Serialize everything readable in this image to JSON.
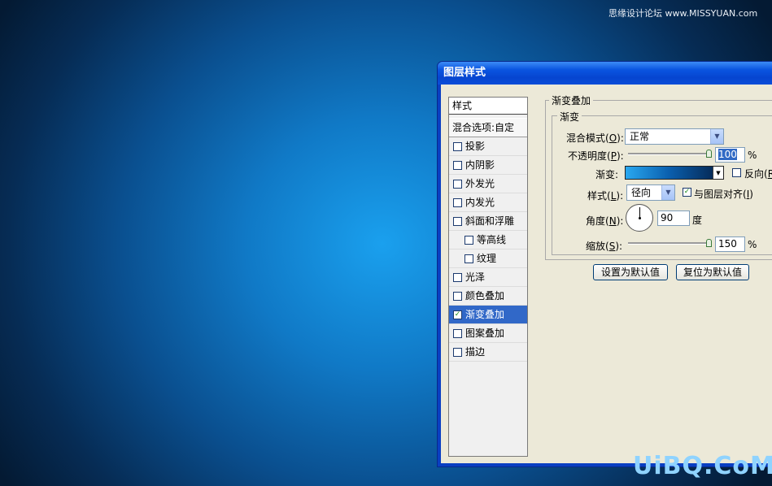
{
  "watermark_top": "思缘设计论坛 www.MISSYUAN.com",
  "watermark_bottom": "UiBQ.CoM",
  "dialog": {
    "title": "图层样式",
    "styles_header": "样式",
    "blend_options": "混合选项:自定",
    "items": [
      {
        "label": "投影",
        "checked": false
      },
      {
        "label": "内阴影",
        "checked": false
      },
      {
        "label": "外发光",
        "checked": false
      },
      {
        "label": "内发光",
        "checked": false
      },
      {
        "label": "斜面和浮雕",
        "checked": false
      },
      {
        "label": "等高线",
        "checked": false
      },
      {
        "label": "纹理",
        "checked": false
      },
      {
        "label": "光泽",
        "checked": false
      },
      {
        "label": "颜色叠加",
        "checked": false
      },
      {
        "label": "渐变叠加",
        "checked": true
      },
      {
        "label": "图案叠加",
        "checked": false
      },
      {
        "label": "描边",
        "checked": false
      }
    ],
    "panel": {
      "outer_title": "渐变叠加",
      "inner_title": "渐变",
      "blend_mode_label": "混合模式",
      "blend_mode_key": "O",
      "blend_mode_value": "正常",
      "opacity_label": "不透明度",
      "opacity_key": "P",
      "opacity_value": "100",
      "percent": "%",
      "gradient_label": "渐变:",
      "reverse_label": "反向",
      "reverse_key": "R",
      "style_label": "样式",
      "style_key": "L",
      "style_value": "径向",
      "align_label": "与图层对齐",
      "align_key": "I",
      "angle_label": "角度",
      "angle_key": "N",
      "angle_value": "90",
      "angle_unit": "度",
      "scale_label": "缩放",
      "scale_key": "S",
      "scale_value": "150",
      "make_default": "设置为默认值",
      "reset_default": "复位为默认值"
    }
  }
}
